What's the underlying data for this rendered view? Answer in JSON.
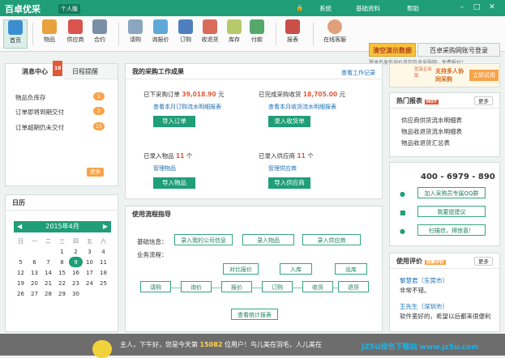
{
  "title": {
    "logo": "百卓优采",
    "edition": "个人版",
    "menus": [
      "系统",
      "基础资料",
      "帮助"
    ]
  },
  "toolbar": {
    "items": [
      "首页",
      "物品",
      "供应商",
      "合约",
      "请购",
      "询报价",
      "订购",
      "收退货",
      "库存",
      "付款",
      "报表",
      "在线客服"
    ],
    "demo": "清空演示数据",
    "login": "百卓采购网账号登录",
    "hint": "登录后发布询价单到百卓采购网，免费报价！"
  },
  "messages": {
    "tab1": "消息中心",
    "badge": "18",
    "tab2": "日程提醒",
    "items": [
      {
        "label": "物品负库存",
        "count": "1"
      },
      {
        "label": "订单即将到期交付",
        "count": "2"
      },
      {
        "label": "订单超期仍未交付",
        "count": "15"
      }
    ],
    "more": "更多"
  },
  "calendar": {
    "title": "日历",
    "month": "2015年4月",
    "weekdays": [
      "日",
      "一",
      "二",
      "三",
      "四",
      "五",
      "六"
    ],
    "rows": [
      [
        "",
        "",
        "",
        "1",
        "2",
        "3",
        "4"
      ],
      [
        "5",
        "6",
        "7",
        "8",
        "9",
        "10",
        "11"
      ],
      [
        "12",
        "13",
        "14",
        "15",
        "16",
        "17",
        "18"
      ],
      [
        "19",
        "20",
        "21",
        "22",
        "23",
        "24",
        "25"
      ],
      [
        "26",
        "27",
        "28",
        "29",
        "30",
        "",
        ""
      ]
    ],
    "today": "9"
  },
  "work": {
    "title": "我的采购工作成果",
    "view": "查看工作记录",
    "a1": "已下采购订单",
    "a1v": "39,018.90",
    "a1u": "元",
    "a1l": "查看本月订购流水明细报表",
    "a1b": "导入订单",
    "a2": "已完成采购收货",
    "a2v": "18,705.00",
    "a2u": "元",
    "a2l": "查看本月收货流水明细报表",
    "a2b": "录入收货单",
    "a3": "已录入物品",
    "a3v": "11",
    "a3u": "个",
    "a3l": "管理物品",
    "a3b": "导入物品",
    "a4": "已录入供应商",
    "a4v": "11",
    "a4u": "个",
    "a4l": "管理供应商",
    "a4b": "导入供应商"
  },
  "guide": {
    "title": "使用流程指导",
    "basic": "基础信息：",
    "flow": "业务流程：",
    "b1": "录入我的公司信息",
    "b2": "录入物品",
    "b3": "录入供应商",
    "steps": [
      "请购",
      "询价",
      "报价",
      "订购",
      "收货",
      "退货"
    ],
    "s7": "对比报价",
    "s8": "入库",
    "s9": "出库",
    "s10": "查看统计报表"
  },
  "ad": {
    "tag": "优采企业版",
    "text": "支持多人协同采购",
    "btn": "立即试用"
  },
  "reports": {
    "title": "热门报表",
    "badge": "HOT",
    "more": "更多",
    "items": [
      "供应商供货流水明细表",
      "物品收退货流水明细表",
      "物品收退货汇总表"
    ]
  },
  "contact": {
    "phone": "400 - 6979 - 890",
    "b1": "加入采购员专属QQ群",
    "b2": "我要提建议",
    "b3": "扫描信，得惊喜！"
  },
  "reviews": {
    "title": "使用评价",
    "badge": "我要评价",
    "more": "更多",
    "items": [
      {
        "name": "黎慧君（东莞市）",
        "text": "非常不错。"
      },
      {
        "name": "王先生（深圳市）",
        "text": "软件蛮好的，希望以后都来很便利"
      }
    ]
  },
  "footer": {
    "text1": "主人，下午好，您是今天第",
    "count": "15082",
    "text2": "位用户！鸟儿美在羽毛，人儿美在"
  },
  "watermark": "JZ5U绿色下载站 www.jz5u.com"
}
